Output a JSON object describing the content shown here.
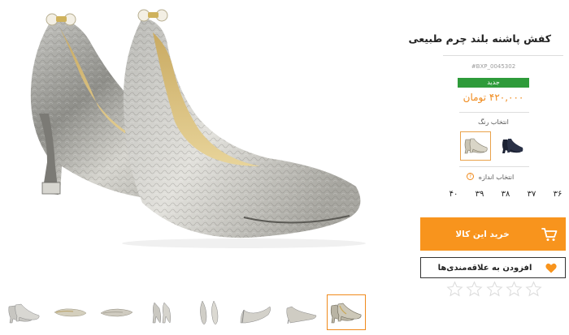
{
  "product": {
    "title": "کفش پاشنه بلند چرم طبیعی",
    "sku": "#BXP_0045302",
    "badge": "جدید",
    "price": "۴۲۰,۰۰۰ تومان"
  },
  "colors": {
    "label": "انتخاب رنگ",
    "options": [
      {
        "name": "silver",
        "color": "#c9c4b4",
        "selected": true
      },
      {
        "name": "navy",
        "color": "#1c2233",
        "selected": false
      }
    ]
  },
  "sizes": {
    "label": "انتخاب اندازه",
    "help_icon": "question-icon",
    "options": [
      "۳۶",
      "۳۷",
      "۳۸",
      "۳۹",
      "۴۰"
    ]
  },
  "actions": {
    "buy_label": "خرید این کالا",
    "buy_icon": "cart-icon",
    "wishlist_label": "افزودن به علاقه‌مندی‌ها",
    "wishlist_icon": "heart-icon"
  },
  "rating": {
    "max": 5,
    "value": 0
  },
  "theme": {
    "accent": "#f8941d",
    "badge": "#2e9b3a",
    "text": "#222222"
  },
  "thumbnails": {
    "count": 8,
    "active_index": 7
  }
}
